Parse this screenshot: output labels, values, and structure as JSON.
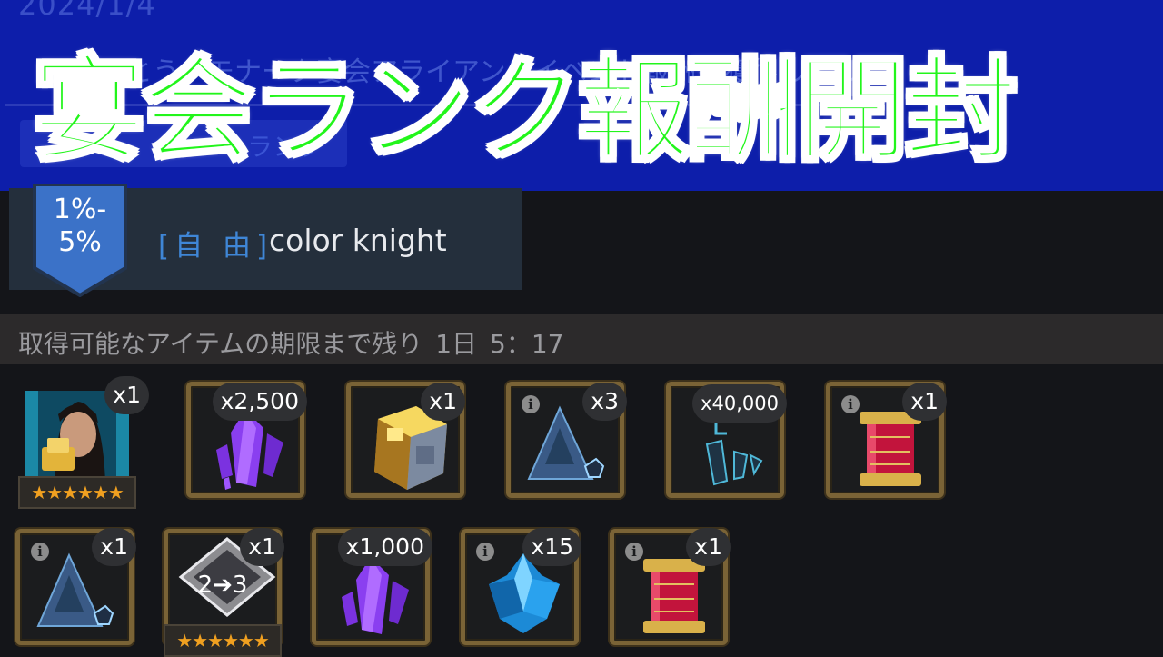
{
  "banner": {
    "date": "2024/1/4",
    "message": "おめでとう、モナーク宴会アライアンスイベント報酬を獲得しました",
    "tab_label": "ランク",
    "title": "宴会ランク報酬開封"
  },
  "rank": {
    "badge_line1": "1%-",
    "badge_line2": "5%",
    "tag": "[自 由]",
    "player_name": "color knight"
  },
  "timer": {
    "label": "取得可能なアイテムの期限まで残り",
    "days": "1日",
    "time": "5：17"
  },
  "rewards": [
    {
      "icon": "champion-portrait-icon",
      "qty": "x1",
      "stars": "★★★★★★"
    },
    {
      "icon": "purple-crystal-shards-icon",
      "qty": "x2,500"
    },
    {
      "icon": "gold-cube-crystal-icon",
      "qty": "x1"
    },
    {
      "icon": "blue-rune-shard-icon",
      "qty": "x3"
    },
    {
      "icon": "cyan-crystal-shards-icon",
      "qty": "x40,000"
    },
    {
      "icon": "red-gold-scroll-icon",
      "qty": "x1"
    },
    {
      "icon": "blue-rune-shard-icon",
      "qty": "x1"
    },
    {
      "icon": "rank-up-gem-icon",
      "qty": "x1",
      "label": "2➔3",
      "stars": "★★★★★★"
    },
    {
      "icon": "purple-crystal-shards-icon",
      "qty": "x1,000"
    },
    {
      "icon": "blue-ice-crystal-icon",
      "qty": "x15"
    },
    {
      "icon": "red-gold-scroll-icon",
      "qty": "x1"
    }
  ],
  "colors": {
    "banner_bg": "#0d1eaa",
    "title_green": "#22f51b",
    "frame_gold": "#7a6336",
    "tag_blue": "#3f86d6"
  }
}
